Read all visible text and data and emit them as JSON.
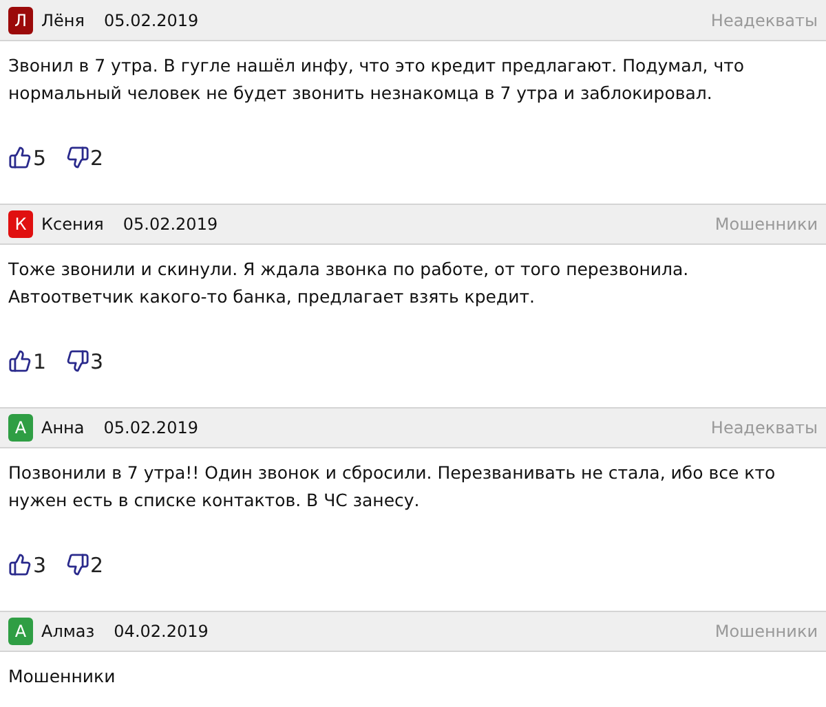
{
  "comments": [
    {
      "initial": "Л",
      "color": "#9b0a0a",
      "author": "Лёня",
      "date": "05.02.2019",
      "category": "Неадекваты",
      "text": "Звонил в 7 утра. В гугле нашёл инфу, что это кредит предлагают. Подумал, что нормальный человек не будет звонить незнакомца в 7 утра и заблокировал.",
      "likes": "5",
      "dislikes": "2"
    },
    {
      "initial": "К",
      "color": "#e01010",
      "author": "Ксения",
      "date": "05.02.2019",
      "category": "Мошенники",
      "text": "Тоже звонили и скинули. Я ждала звонка по работе, от того перезвонила. Автоответчик какого-то банка, предлагает взять кредит.",
      "likes": "1",
      "dislikes": "3"
    },
    {
      "initial": "А",
      "color": "#2f9e44",
      "author": "Анна",
      "date": "05.02.2019",
      "category": "Неадекваты",
      "text": "Позвонили в 7 утра!! Один звонок и сбросили. Перезванивать не стала, ибо все кто нужен есть в списке контактов. В ЧС занесу.",
      "likes": "3",
      "dislikes": "2"
    },
    {
      "initial": "А",
      "color": "#2f9e44",
      "author": "Алмаз",
      "date": "04.02.2019",
      "category": "Мошенники",
      "text": "Мошенники"
    }
  ]
}
